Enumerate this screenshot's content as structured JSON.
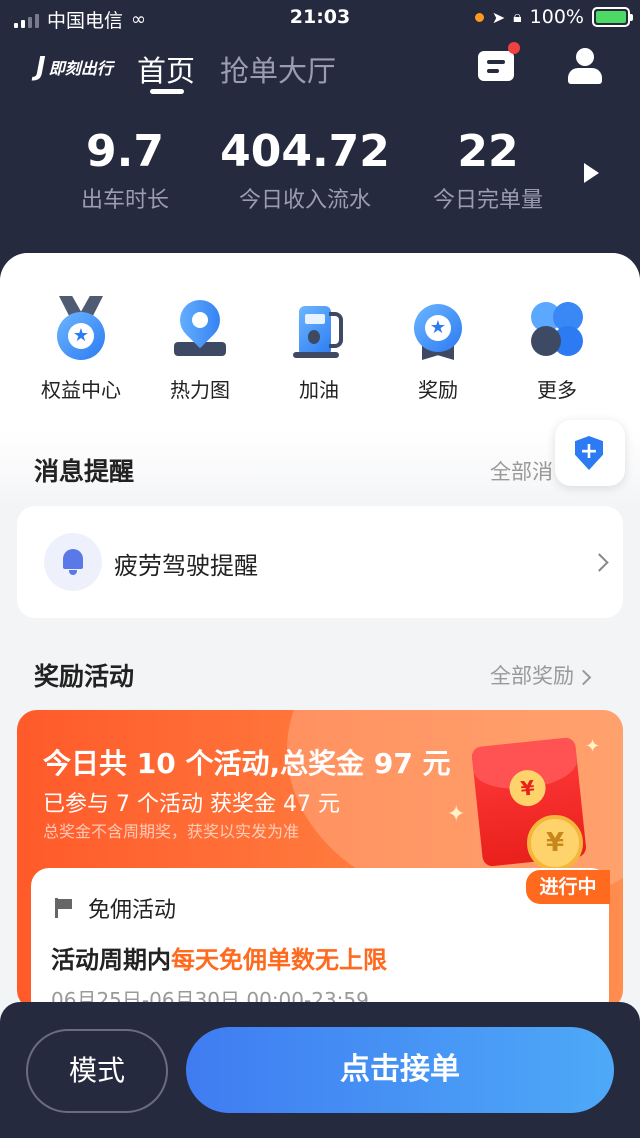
{
  "status_bar": {
    "carrier": "中国电信",
    "time": "21:03",
    "battery": "100%"
  },
  "header": {
    "logo": "即刻出行",
    "tabs": [
      {
        "label": "首页",
        "active": true
      },
      {
        "label": "抢单大厅",
        "active": false
      }
    ]
  },
  "stats": [
    {
      "value": "9.7",
      "label": "出车时长"
    },
    {
      "value": "404.72",
      "label": "今日收入流水"
    },
    {
      "value": "22",
      "label": "今日完单量"
    }
  ],
  "quick_actions": [
    {
      "label": "权益中心",
      "icon": "medal-icon"
    },
    {
      "label": "热力图",
      "icon": "map-pin-icon"
    },
    {
      "label": "加油",
      "icon": "fuel-pump-icon"
    },
    {
      "label": "奖励",
      "icon": "award-icon"
    },
    {
      "label": "更多",
      "icon": "more-icon"
    }
  ],
  "messages": {
    "title": "消息提醒",
    "more": "全部消",
    "items": [
      {
        "text": "疲劳驾驶提醒"
      }
    ]
  },
  "rewards": {
    "title": "奖励活动",
    "more": "全部奖励",
    "summary": "今日共 10 个活动,总奖金 97 元",
    "joined": "已参与 7 个活动 获奖金 47 元",
    "note": "总奖金不含周期奖，获奖以实发为准",
    "status": "进行中",
    "activity": {
      "title": "免佣活动",
      "line_prefix": "活动周期内",
      "line_highlight": "每天免佣单数无上限",
      "period": "06月25日-06月30日 00:00-23:59"
    }
  },
  "bottom": {
    "mode": "模式",
    "accept": "点击接单"
  },
  "colors": {
    "header_bg": "#262a3f",
    "accent_blue": "#3f7cf2",
    "promo_orange": "#ff5a2a",
    "highlight_orange": "#ff6a1f"
  }
}
